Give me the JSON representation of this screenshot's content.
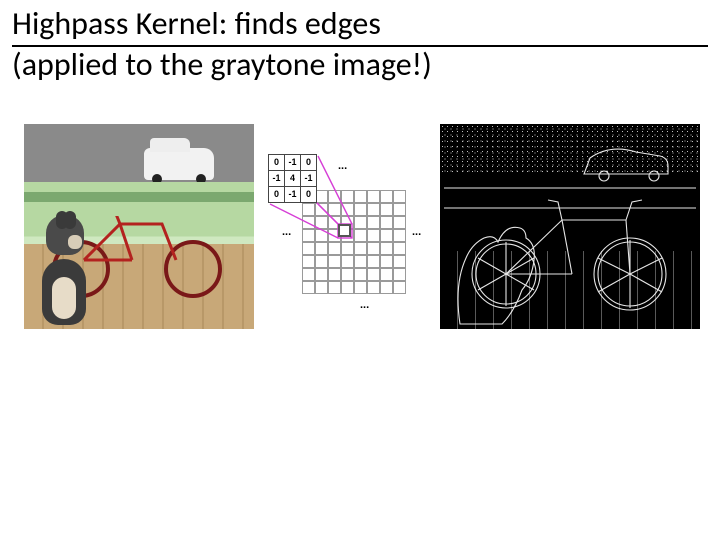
{
  "title": {
    "line1": "Highpass Kernel: finds edges",
    "line2": "(applied to the graytone image!)"
  },
  "kernel": {
    "rows": [
      [
        "0",
        "-1",
        "0"
      ],
      [
        "-1",
        "4",
        "-1"
      ],
      [
        "0",
        "-1",
        "0"
      ]
    ],
    "ellipsis": "..."
  },
  "figures": {
    "left": "input-photo-dog-and-bicycle",
    "middle": "convolution-kernel-diagram",
    "right": "edge-detected-output"
  }
}
